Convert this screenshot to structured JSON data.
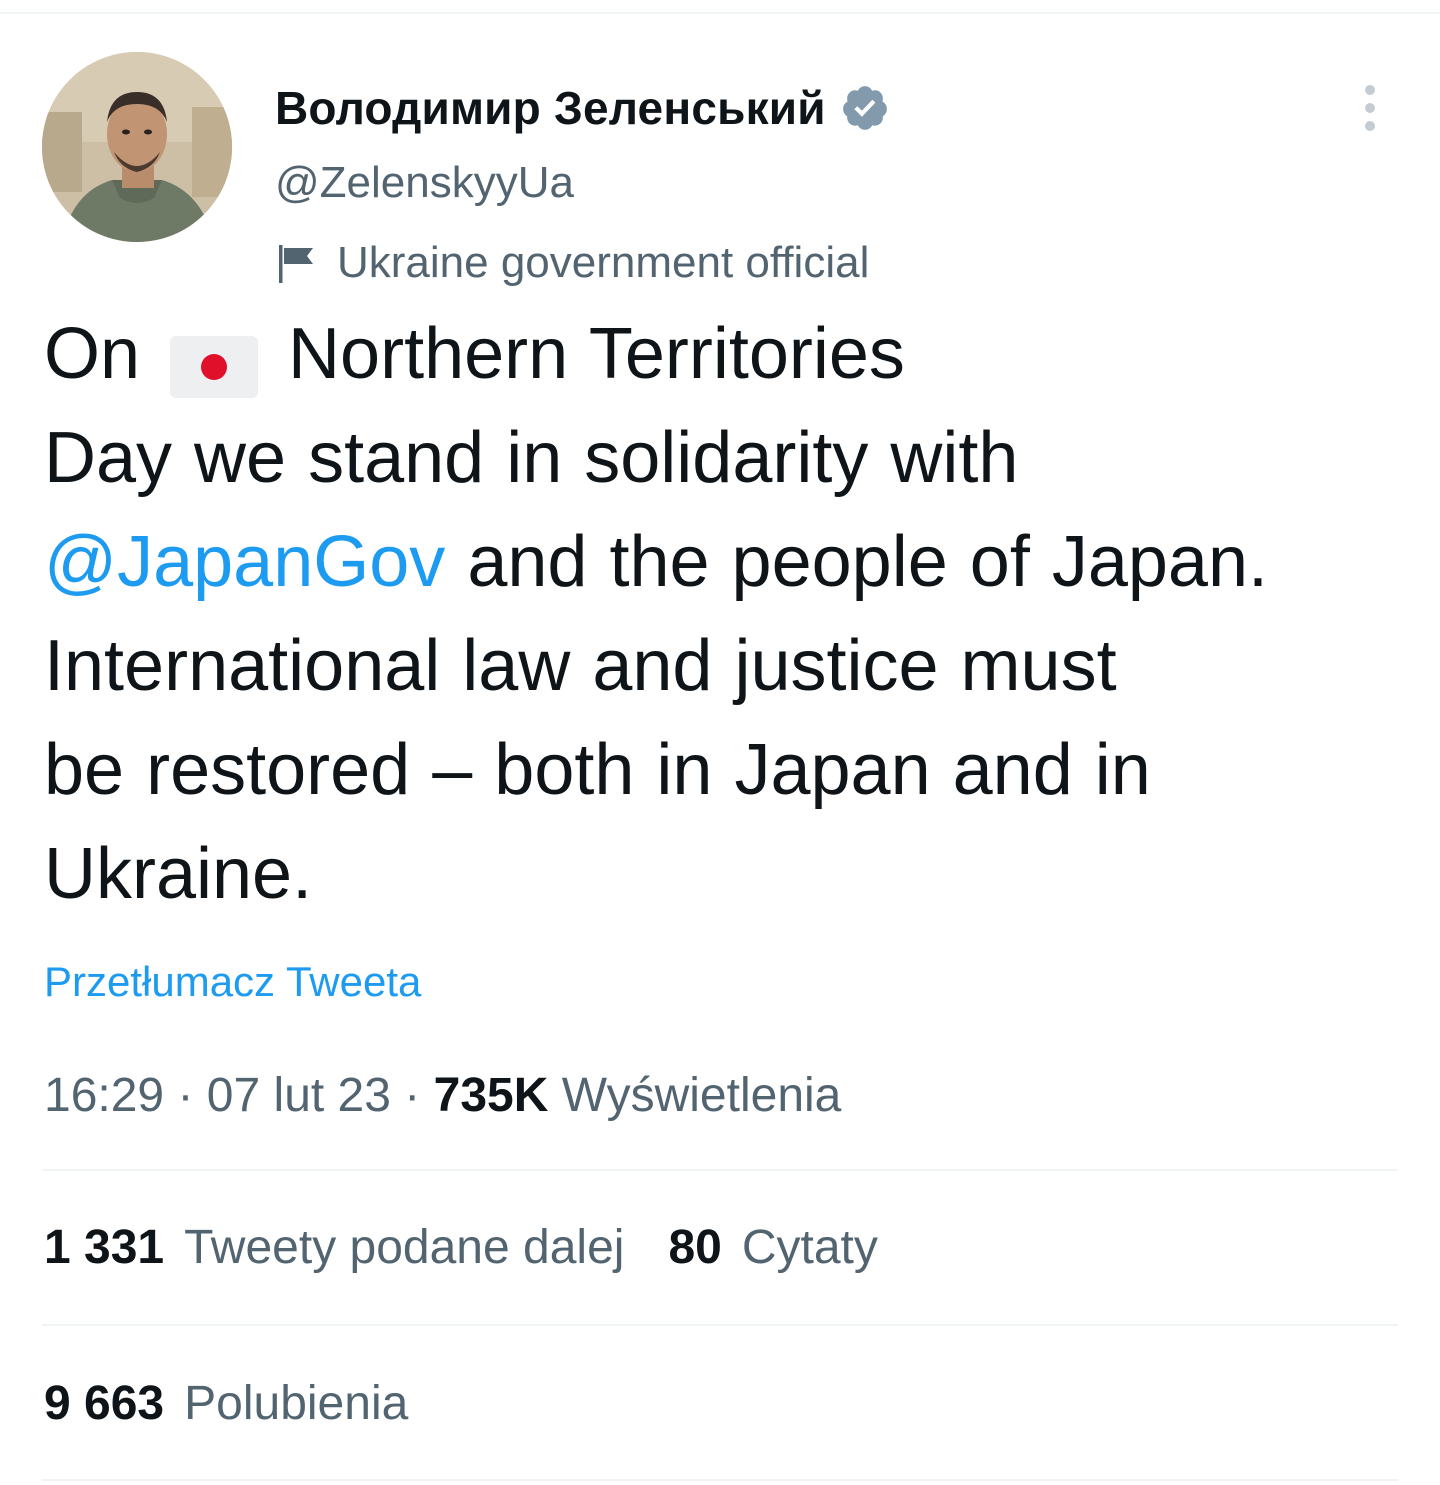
{
  "author": {
    "display_name": "Володимир Зеленський",
    "handle": "@ZelenskyyUa",
    "label": "Ukraine government official"
  },
  "tweet": {
    "line1_pre": "On",
    "line1_post": "Northern Territories",
    "line2": "Day we stand in solidarity with",
    "mention": "@JapanGov",
    "line3_post": "and the people of Japan.",
    "line4": "International law and justice must",
    "line5": "be restored – both in Japan and in",
    "line6": "Ukraine.",
    "emoji_flag": "japan-flag"
  },
  "translate_label": "Przetłumacz Tweeta",
  "meta": {
    "time": "16:29",
    "sep1": "·",
    "date": "07 lut 23",
    "sep2": "·",
    "views_count": "735K",
    "views_label": "Wyświetlenia"
  },
  "stats": {
    "retweets_count": "1 331",
    "retweets_label": "Tweety podane dalej",
    "quotes_count": "80",
    "quotes_label": "Cytaty",
    "likes_count": "9 663",
    "likes_label": "Polubienia"
  },
  "colors": {
    "accent": "#1d9bf0",
    "text": "#0f1419",
    "secondary": "#536471",
    "divider": "#eff3f4",
    "verified_badge": "#829aab",
    "flag_red": "#e0102a"
  }
}
